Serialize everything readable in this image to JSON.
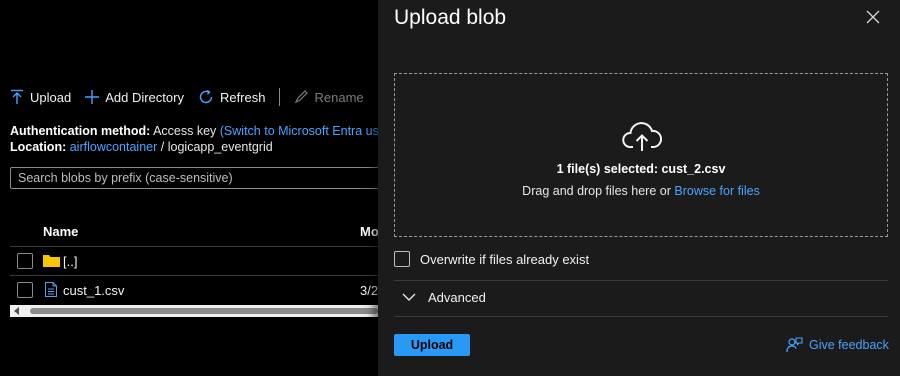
{
  "toolbar": {
    "upload": "Upload",
    "add_directory": "Add Directory",
    "refresh": "Refresh",
    "rename": "Rename"
  },
  "auth": {
    "label": "Authentication method:",
    "value": "Access key",
    "switch_link": "(Switch to Microsoft Entra user a"
  },
  "location": {
    "label": "Location:",
    "container": "airflowcontainer",
    "separator": "/",
    "folder": "logicapp_eventgrid"
  },
  "search": {
    "placeholder": "Search blobs by prefix (case-sensitive)"
  },
  "table": {
    "columns": [
      "Name",
      "Mo"
    ],
    "rows": [
      {
        "name": "[..]",
        "type": "folder",
        "date": ""
      },
      {
        "name": "cust_1.csv",
        "type": "file",
        "date": "3/2"
      }
    ]
  },
  "panel": {
    "title": "Upload blob",
    "selected_text": "1 file(s) selected: cust_2.csv",
    "drag_text": "Drag and drop files here",
    "or_text": "or",
    "browse_link": "Browse for files",
    "overwrite_label": "Overwrite if files already exist",
    "advanced_label": "Advanced",
    "upload_button": "Upload",
    "feedback_link": "Give feedback"
  },
  "colors": {
    "accent": "#4aa3ff",
    "primary_button": "#2899f5",
    "panel_bg": "#1b1b1b",
    "page_bg": "#000000",
    "folder": "#f7c600"
  }
}
